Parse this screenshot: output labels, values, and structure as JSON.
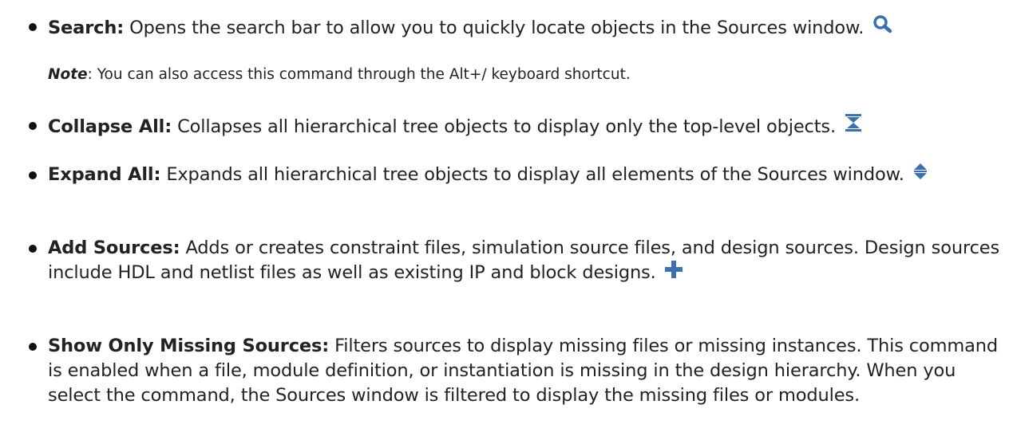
{
  "colors": {
    "text": "#222222",
    "icon": "#3a6fb0"
  },
  "items": [
    {
      "term": "Search:",
      "desc": " Opens the search bar to allow you to quickly locate objects in the Sources window.",
      "icon": "search-icon"
    },
    {
      "term": "Collapse All:",
      "desc": " Collapses all hierarchical tree objects to display only the top-level objects.",
      "icon": "collapse-all-icon"
    },
    {
      "term": "Expand All:",
      "desc": " Expands all hierarchical tree objects to display all elements of the Sources window.",
      "icon": "expand-all-icon"
    },
    {
      "term": "Add Sources:",
      "desc": " Adds or creates constraint files, simulation source files, and design sources. Design sources include HDL and netlist files as well as existing IP and block designs.",
      "icon": "plus-icon"
    },
    {
      "term": "Show Only Missing Sources:",
      "desc": " Filters sources to display missing files or missing instances. This command is enabled when a file, module definition, or instantiation is missing in the design hierarchy. When you select the command, the Sources window is filtered to display the missing files or modules."
    }
  ],
  "note": {
    "label": "Note",
    "text": ": You can also access this command through the Alt+/ keyboard shortcut."
  }
}
